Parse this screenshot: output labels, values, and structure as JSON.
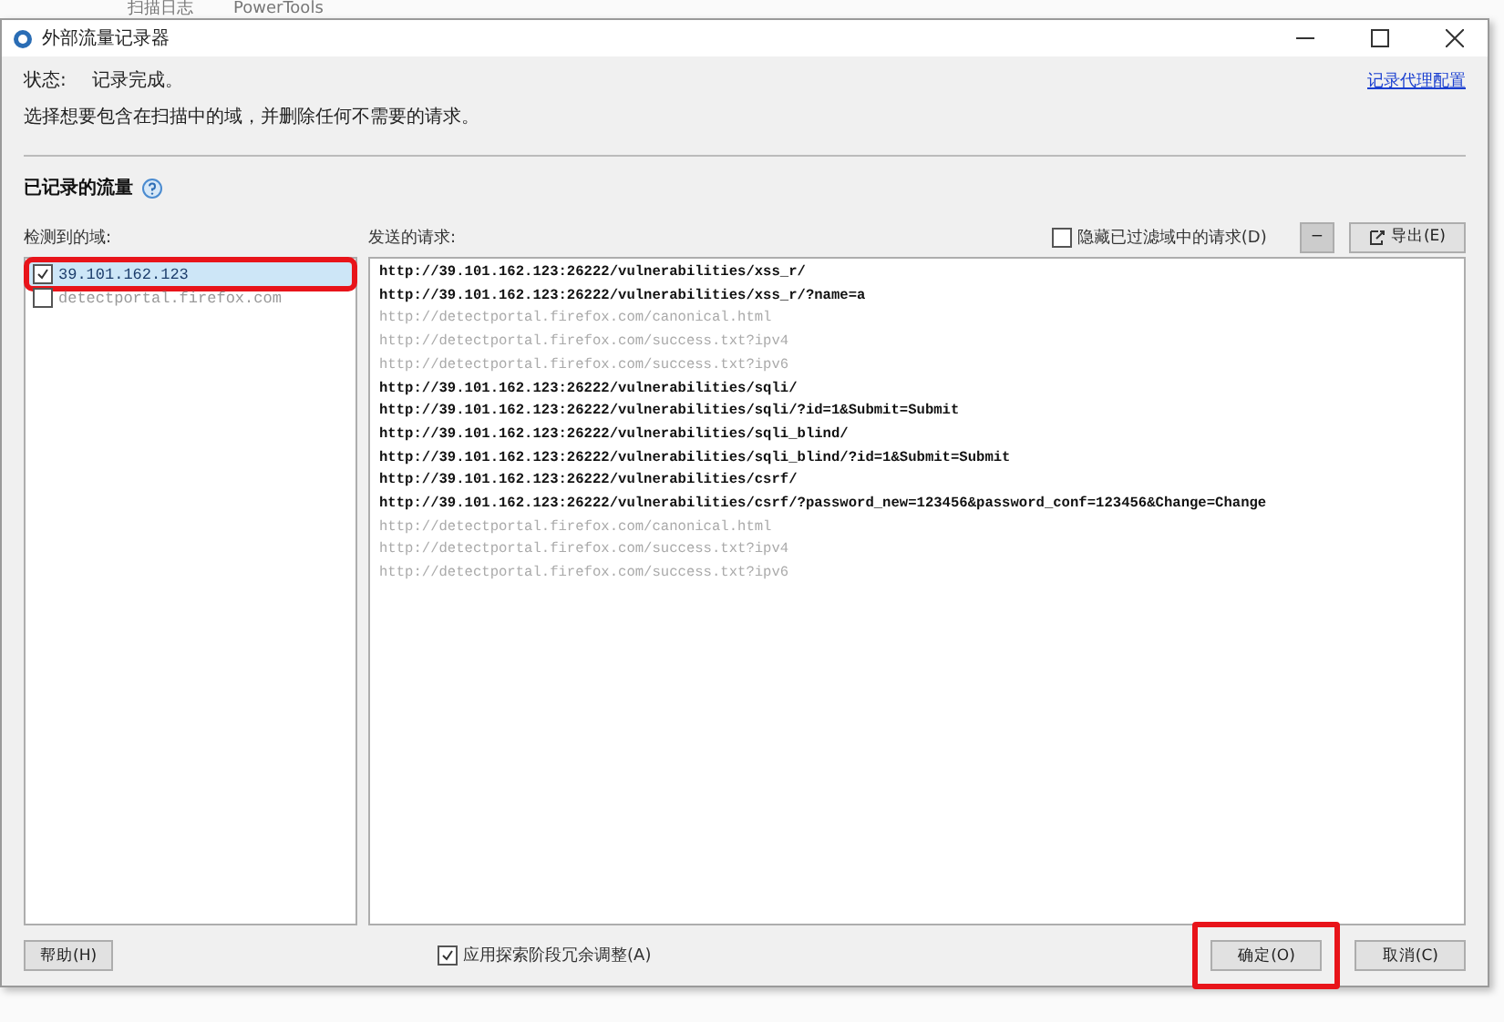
{
  "background_tabs": [
    "扫描日志",
    "PowerTools"
  ],
  "window": {
    "title": "外部流量记录器"
  },
  "status": {
    "label": "状态:",
    "value": "记录完成。"
  },
  "instruction": "选择想要包含在扫描中的域，并删除任何不需要的请求。",
  "proxy_link": "记录代理配置",
  "section_title": "已记录的流量",
  "domains": {
    "label": "检测到的域:",
    "items": [
      {
        "name": "39.101.162.123",
        "checked": true,
        "selected": true,
        "highlighted": true
      },
      {
        "name": "detectportal.firefox.com",
        "checked": false,
        "selected": false,
        "highlighted": false
      }
    ]
  },
  "requests": {
    "label": "发送的请求:",
    "hide_filtered": {
      "label": "隐藏已过滤域中的请求(D)",
      "checked": false
    },
    "remove_button": "−",
    "export_button": "导出(E)",
    "items": [
      {
        "url": "http://39.101.162.123:26222/vulnerabilities/xss_r/",
        "kind": "included"
      },
      {
        "url": "http://39.101.162.123:26222/vulnerabilities/xss_r/?name=a",
        "kind": "included"
      },
      {
        "url": "http://detectportal.firefox.com/canonical.html",
        "kind": "filtered"
      },
      {
        "url": "http://detectportal.firefox.com/success.txt?ipv4",
        "kind": "filtered"
      },
      {
        "url": "http://detectportal.firefox.com/success.txt?ipv6",
        "kind": "filtered"
      },
      {
        "url": "http://39.101.162.123:26222/vulnerabilities/sqli/",
        "kind": "included"
      },
      {
        "url": "http://39.101.162.123:26222/vulnerabilities/sqli/?id=1&Submit=Submit",
        "kind": "included"
      },
      {
        "url": "http://39.101.162.123:26222/vulnerabilities/sqli_blind/",
        "kind": "included"
      },
      {
        "url": "http://39.101.162.123:26222/vulnerabilities/sqli_blind/?id=1&Submit=Submit",
        "kind": "included"
      },
      {
        "url": "http://39.101.162.123:26222/vulnerabilities/csrf/",
        "kind": "included"
      },
      {
        "url": "http://39.101.162.123:26222/vulnerabilities/csrf/?password_new=123456&password_conf=123456&Change=Change",
        "kind": "included"
      },
      {
        "url": "http://detectportal.firefox.com/canonical.html",
        "kind": "filtered"
      },
      {
        "url": "http://detectportal.firefox.com/success.txt?ipv4",
        "kind": "filtered"
      },
      {
        "url": "http://detectportal.firefox.com/success.txt?ipv6",
        "kind": "filtered"
      }
    ]
  },
  "footer": {
    "help_button": "帮助(H)",
    "apply_option": {
      "label": "应用探索阶段冗余调整(A)",
      "checked": true
    },
    "buttons": [
      {
        "label": "确定(O)",
        "highlighted": true
      },
      {
        "label": "取消(C)",
        "highlighted": false
      }
    ]
  }
}
